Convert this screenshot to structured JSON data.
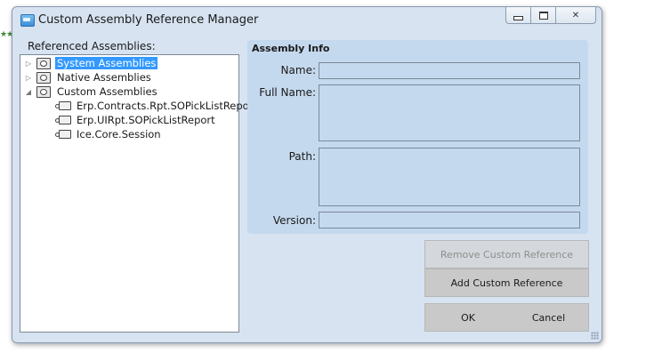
{
  "window": {
    "title": "Custom Assembly Reference Manager"
  },
  "tree": {
    "label": "Referenced Assemblies:",
    "items": [
      {
        "label": "System Assemblies",
        "arrow": "▷",
        "selected": true
      },
      {
        "label": "Native Assemblies",
        "arrow": "▷",
        "selected": false
      },
      {
        "label": "Custom Assemblies",
        "arrow": "◢",
        "selected": false
      },
      {
        "label": "Erp.Contracts.Rpt.SOPickListReport"
      },
      {
        "label": "Erp.UIRpt.SOPickListReport"
      },
      {
        "label": "Ice.Core.Session"
      }
    ]
  },
  "info": {
    "title": "Assembly Info",
    "name_label": "Name:",
    "name_value": "",
    "full_name_label": "Full Name:",
    "full_name_value": "",
    "path_label": "Path:",
    "path_value": "",
    "version_label": "Version:",
    "version_value": ""
  },
  "buttons": {
    "remove": "Remove Custom Reference",
    "add": "Add Custom Reference",
    "ok": "OK",
    "cancel": "Cancel"
  },
  "colors": {
    "window_bg": "#d7e3f1",
    "panel_bg": "#c5d9ee",
    "selection": "#3399ff",
    "button": "#c9c9c9"
  }
}
